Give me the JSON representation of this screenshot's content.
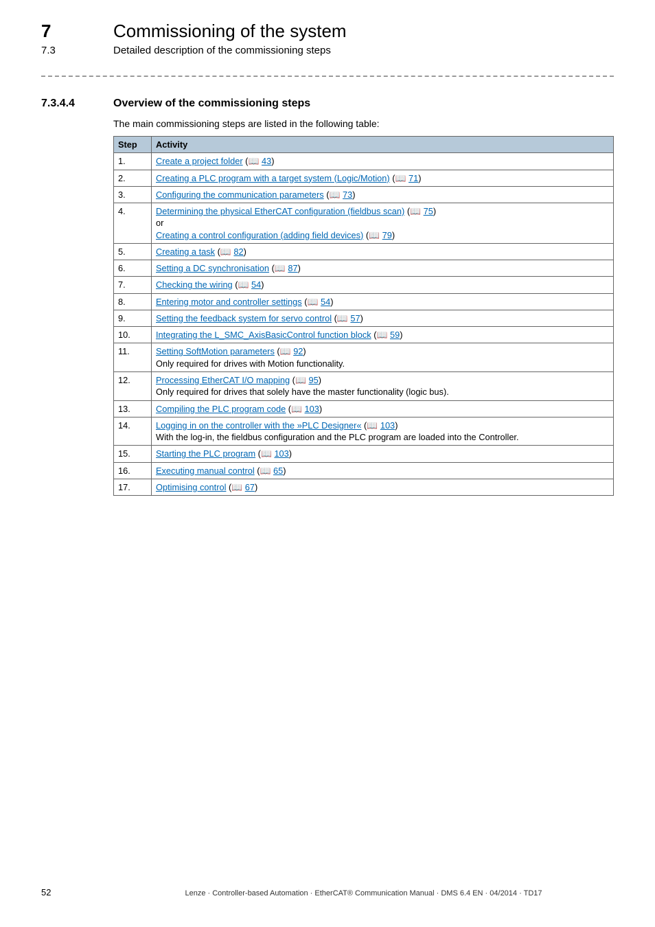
{
  "header": {
    "chapter_num": "7",
    "chapter_title": "Commissioning of the system",
    "sub_num": "7.3",
    "sub_title": "Detailed description of the commissioning steps"
  },
  "section": {
    "num": "7.3.4.4",
    "title": "Overview of the commissioning steps",
    "intro": "The main commissioning steps are listed in the following table:"
  },
  "table": {
    "headers": {
      "step": "Step",
      "activity": "Activity"
    },
    "rows": [
      {
        "step": "1.",
        "parts": [
          {
            "t": "link",
            "text": "Create a project folder"
          },
          {
            "t": "text",
            "text": " ("
          },
          {
            "t": "ref",
            "text": "43"
          },
          {
            "t": "text",
            "text": ")"
          }
        ]
      },
      {
        "step": "2.",
        "parts": [
          {
            "t": "link",
            "text": "Creating a PLC program with a target system (Logic/Motion)"
          },
          {
            "t": "text",
            "text": " ("
          },
          {
            "t": "ref",
            "text": "71"
          },
          {
            "t": "text",
            "text": ")"
          }
        ]
      },
      {
        "step": "3.",
        "parts": [
          {
            "t": "link",
            "text": "Configuring the communication parameters"
          },
          {
            "t": "text",
            "text": " ("
          },
          {
            "t": "ref",
            "text": "73"
          },
          {
            "t": "text",
            "text": ")"
          }
        ]
      },
      {
        "step": "4.",
        "parts": [
          {
            "t": "link",
            "text": "Determining the physical EtherCAT configuration (fieldbus scan)"
          },
          {
            "t": "text",
            "text": " ("
          },
          {
            "t": "ref",
            "text": "75"
          },
          {
            "t": "text",
            "text": ")"
          },
          {
            "t": "br"
          },
          {
            "t": "text",
            "text": "or"
          },
          {
            "t": "br"
          },
          {
            "t": "link",
            "text": "Creating a control configuration (adding field devices)"
          },
          {
            "t": "text",
            "text": " ("
          },
          {
            "t": "ref",
            "text": "79"
          },
          {
            "t": "text",
            "text": ")"
          }
        ]
      },
      {
        "step": "5.",
        "parts": [
          {
            "t": "link",
            "text": "Creating a task"
          },
          {
            "t": "text",
            "text": " ("
          },
          {
            "t": "ref",
            "text": "82"
          },
          {
            "t": "text",
            "text": ")"
          }
        ]
      },
      {
        "step": "6.",
        "parts": [
          {
            "t": "link",
            "text": "Setting a DC synchronisation"
          },
          {
            "t": "text",
            "text": " ("
          },
          {
            "t": "ref",
            "text": "87"
          },
          {
            "t": "text",
            "text": ")"
          }
        ]
      },
      {
        "step": "7.",
        "parts": [
          {
            "t": "link",
            "text": "Checking the wiring"
          },
          {
            "t": "text",
            "text": " ("
          },
          {
            "t": "ref",
            "text": "54"
          },
          {
            "t": "text",
            "text": ")"
          }
        ]
      },
      {
        "step": "8.",
        "parts": [
          {
            "t": "link",
            "text": "Entering motor and controller settings"
          },
          {
            "t": "text",
            "text": " ("
          },
          {
            "t": "ref",
            "text": "54"
          },
          {
            "t": "text",
            "text": ")"
          }
        ]
      },
      {
        "step": "9.",
        "parts": [
          {
            "t": "link",
            "text": "Setting the feedback system for servo control"
          },
          {
            "t": "text",
            "text": " ("
          },
          {
            "t": "ref",
            "text": "57"
          },
          {
            "t": "text",
            "text": ")"
          }
        ]
      },
      {
        "step": "10.",
        "parts": [
          {
            "t": "link",
            "text": "Integrating the L_SMC_AxisBasicControl function block"
          },
          {
            "t": "text",
            "text": " ("
          },
          {
            "t": "ref",
            "text": "59"
          },
          {
            "t": "text",
            "text": ")"
          }
        ]
      },
      {
        "step": "11.",
        "parts": [
          {
            "t": "link",
            "text": "Setting SoftMotion parameters"
          },
          {
            "t": "text",
            "text": " ("
          },
          {
            "t": "ref",
            "text": "92"
          },
          {
            "t": "text",
            "text": ")"
          },
          {
            "t": "br"
          },
          {
            "t": "text",
            "text": "Only required for drives with Motion functionality."
          }
        ]
      },
      {
        "step": "12.",
        "parts": [
          {
            "t": "link",
            "text": "Processing EtherCAT I/O mapping"
          },
          {
            "t": "text",
            "text": " ("
          },
          {
            "t": "ref",
            "text": "95"
          },
          {
            "t": "text",
            "text": ")"
          },
          {
            "t": "br"
          },
          {
            "t": "text",
            "text": "Only required for drives that solely have the master functionality (logic bus)."
          }
        ]
      },
      {
        "step": "13.",
        "parts": [
          {
            "t": "link",
            "text": "Compiling the PLC program code"
          },
          {
            "t": "text",
            "text": " ("
          },
          {
            "t": "ref",
            "text": "103"
          },
          {
            "t": "text",
            "text": ")"
          }
        ]
      },
      {
        "step": "14.",
        "parts": [
          {
            "t": "link",
            "text": "Logging in on the controller with the »PLC Designer«"
          },
          {
            "t": "text",
            "text": " ("
          },
          {
            "t": "ref",
            "text": "103"
          },
          {
            "t": "text",
            "text": ")"
          },
          {
            "t": "br"
          },
          {
            "t": "text",
            "text": "With the log-in, the fieldbus configuration and the PLC program are loaded into the Controller."
          }
        ]
      },
      {
        "step": "15.",
        "parts": [
          {
            "t": "link",
            "text": "Starting the PLC program"
          },
          {
            "t": "text",
            "text": " ("
          },
          {
            "t": "ref",
            "text": "103"
          },
          {
            "t": "text",
            "text": ")"
          }
        ]
      },
      {
        "step": "16.",
        "parts": [
          {
            "t": "link",
            "text": "Executing manual control"
          },
          {
            "t": "text",
            "text": " ("
          },
          {
            "t": "ref",
            "text": "65"
          },
          {
            "t": "text",
            "text": ")"
          }
        ]
      },
      {
        "step": "17.",
        "parts": [
          {
            "t": "link",
            "text": "Optimising control"
          },
          {
            "t": "text",
            "text": " ("
          },
          {
            "t": "ref",
            "text": "67"
          },
          {
            "t": "text",
            "text": ")"
          }
        ]
      }
    ]
  },
  "footer": {
    "page": "52",
    "text": "Lenze · Controller-based Automation · EtherCAT® Communication Manual · DMS 6.4 EN · 04/2014 · TD17"
  }
}
